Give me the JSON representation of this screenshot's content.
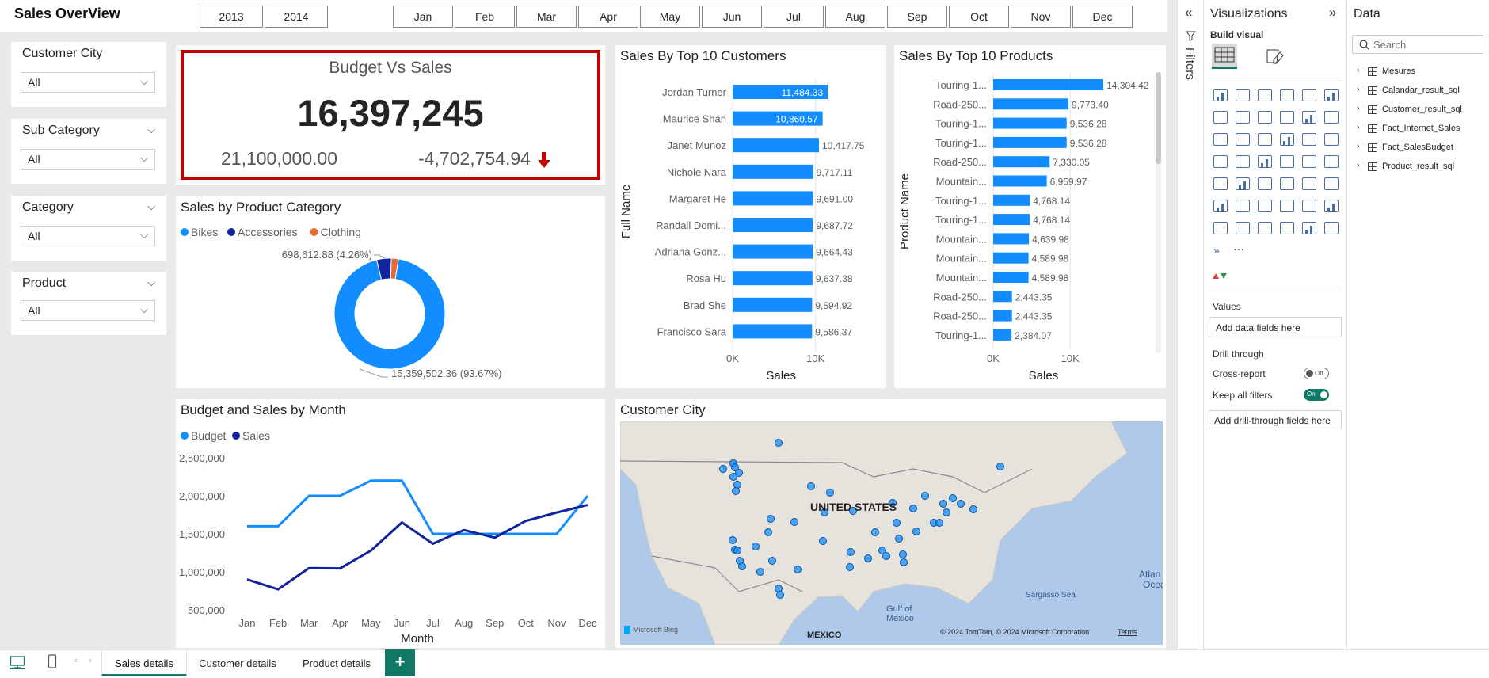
{
  "report": {
    "title": "Sales OverView",
    "years": [
      "2013",
      "2014"
    ],
    "months": [
      "Jan",
      "Feb",
      "Mar",
      "Apr",
      "May",
      "Jun",
      "Jul",
      "Aug",
      "Sep",
      "Oct",
      "Nov",
      "Dec"
    ]
  },
  "slicers": [
    {
      "label": "Customer City",
      "value": "All"
    },
    {
      "label": "Sub Category",
      "value": "All"
    },
    {
      "label": "Category",
      "value": "All"
    },
    {
      "label": "Product",
      "value": "All"
    }
  ],
  "kpi": {
    "title": "Budget Vs Sales",
    "value": "16,397,245",
    "goal": "21,100,000.00",
    "diff": "-4,702,754.94",
    "down_color": "#c00000"
  },
  "category_chart": {
    "title": "Sales by Product Category",
    "legend": [
      "Bikes",
      "Accessories",
      "Clothing"
    ],
    "colors": [
      "#118dff",
      "#12239e",
      "#e66c37"
    ]
  },
  "customers_chart": {
    "title": "Sales By Top 10 Customers",
    "ylabel": "Full Name",
    "xlabel": "Sales",
    "ticks": [
      "0K",
      "10K"
    ]
  },
  "products_chart": {
    "title": "Sales By Top 10 Products",
    "ylabel": "Product Name",
    "xlabel": "Sales",
    "ticks": [
      "0K",
      "10K"
    ]
  },
  "month_chart": {
    "title": "Budget and Sales by Month",
    "legend": [
      "Budget",
      "Sales"
    ],
    "xlabel": "Month",
    "yticks": [
      "2,500,000",
      "2,000,000",
      "1,500,000",
      "1,000,000",
      "500,000"
    ]
  },
  "map": {
    "title": "Customer City",
    "country_label": "UNITED STATES",
    "labels": [
      "MEXICO",
      "Gulf of Mexico",
      "Sargasso Sea",
      "Atlan Ocea"
    ],
    "attribution": "© 2024 TomTom, © 2024 Microsoft Corporation",
    "terms": "Terms",
    "logo": "Microsoft Bing"
  },
  "chart_data": [
    {
      "type": "pie",
      "title": "Sales by Product Category",
      "categories": [
        "Bikes",
        "Accessories",
        "Clothing"
      ],
      "values": [
        15359502.36,
        698612.88,
        339130
      ],
      "labels": [
        "15,359,502.36 (93.67%)",
        "698,612.88 (4.26%)"
      ]
    },
    {
      "type": "bar",
      "title": "Sales By Top 10 Customers",
      "categories": [
        "Jordan Turner",
        "Maurice Shan",
        "Janet Munoz",
        "Nichole Nara",
        "Margaret He",
        "Randall Domi...",
        "Adriana Gonz...",
        "Rosa Hu",
        "Brad She",
        "Francisco Sara"
      ],
      "values": [
        11484.33,
        10860.57,
        10417.75,
        9717.11,
        9691.0,
        9687.72,
        9664.43,
        9637.38,
        9594.92,
        9586.37
      ],
      "value_labels": [
        "11,484.33",
        "10,860.57",
        "10,417.75",
        "9,717.11",
        "9,691.00",
        "9,687.72",
        "9,664.43",
        "9,637.38",
        "9,594.92",
        "9,586.37"
      ],
      "xlabel": "Sales",
      "ylabel": "Full Name",
      "xlim": [
        0,
        13000
      ]
    },
    {
      "type": "bar",
      "title": "Sales By Top 10 Products",
      "categories": [
        "Touring-1...",
        "Road-250...",
        "Touring-1...",
        "Touring-1...",
        "Road-250...",
        "Mountain...",
        "Touring-1...",
        "Touring-1...",
        "Mountain...",
        "Mountain...",
        "Mountain...",
        "Road-250...",
        "Road-250...",
        "Touring-1..."
      ],
      "values": [
        14304.42,
        9773.4,
        9536.28,
        9536.28,
        7330.05,
        6959.97,
        4768.14,
        4768.14,
        4639.98,
        4589.98,
        4589.98,
        2443.35,
        2443.35,
        2384.07
      ],
      "value_labels": [
        "14,304.42",
        "9,773.40",
        "9,536.28",
        "9,536.28",
        "7,330.05",
        "6,959.97",
        "4,768.14",
        "4,768.14",
        "4,639.98",
        "4,589.98",
        "4,589.98",
        "2,443.35",
        "2,443.35",
        "2,384.07"
      ],
      "xlabel": "Sales",
      "ylabel": "Product Name",
      "xlim": [
        0,
        14500
      ]
    },
    {
      "type": "line",
      "title": "Budget and Sales by Month",
      "x": [
        "Jan",
        "Feb",
        "Mar",
        "Apr",
        "May",
        "Jun",
        "Jul",
        "Aug",
        "Sep",
        "Oct",
        "Nov",
        "Dec"
      ],
      "series": [
        {
          "name": "Budget",
          "color": "#118dff",
          "values": [
            1600000,
            1600000,
            2000000,
            2000000,
            2200000,
            2200000,
            1500000,
            1500000,
            1500000,
            1500000,
            1500000,
            2000000
          ]
        },
        {
          "name": "Sales",
          "color": "#12239e",
          "values": [
            900000,
            770000,
            1050000,
            1045000,
            1280000,
            1650000,
            1370000,
            1550000,
            1450000,
            1670000,
            1780000,
            1880000
          ]
        }
      ],
      "xlabel": "Month",
      "ylim": [
        500000,
        2500000
      ]
    }
  ],
  "visualizations_pane": {
    "title": "Visualizations",
    "build_label": "Build visual",
    "values_label": "Values",
    "values_placeholder": "Add data fields here",
    "drill_label": "Drill through",
    "cross_report": "Cross-report",
    "cross_state": "Off",
    "keep_filters": "Keep all filters",
    "keep_state": "On",
    "drill_placeholder": "Add drill-through fields here",
    "more": "···"
  },
  "filters_pane": {
    "label": "Filters"
  },
  "data_pane": {
    "title": "Data",
    "search_placeholder": "Search",
    "tables": [
      "Mesures",
      "Calandar_result_sql",
      "Customer_result_sql",
      "Fact_Internet_Sales",
      "Fact_SalesBudget",
      "Product_result_sql"
    ]
  },
  "tabs": [
    "Sales details",
    "Customer details",
    "Product details"
  ],
  "add_tab": "+"
}
